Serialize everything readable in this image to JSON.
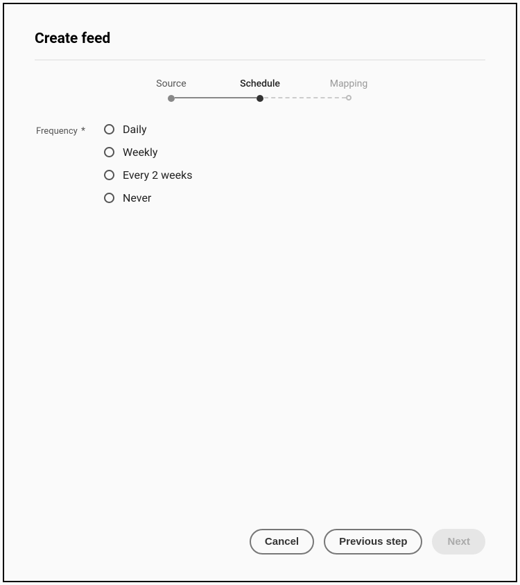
{
  "title": "Create feed",
  "stepper": {
    "steps": [
      {
        "label": "Source",
        "state": "completed"
      },
      {
        "label": "Schedule",
        "state": "active"
      },
      {
        "label": "Mapping",
        "state": "pending"
      }
    ]
  },
  "form": {
    "frequency": {
      "label": "Frequency",
      "required_marker": "*",
      "options": [
        {
          "label": "Daily"
        },
        {
          "label": "Weekly"
        },
        {
          "label": "Every 2 weeks"
        },
        {
          "label": "Never"
        }
      ]
    }
  },
  "footer": {
    "cancel": "Cancel",
    "previous": "Previous step",
    "next": "Next"
  }
}
